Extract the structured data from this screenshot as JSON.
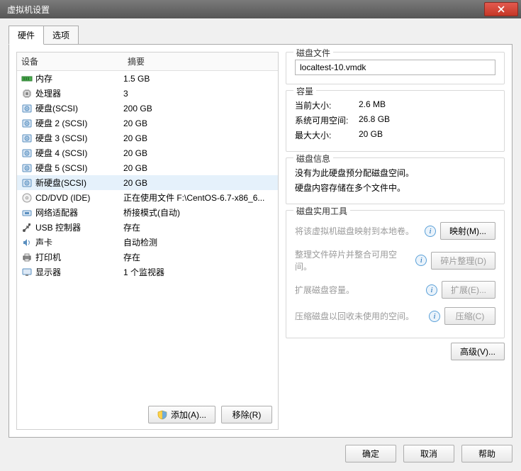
{
  "window": {
    "title": "虚拟机设置"
  },
  "tabs": {
    "hardware": "硬件",
    "options": "选项"
  },
  "left": {
    "col_device": "设备",
    "col_summary": "摘要",
    "rows": [
      {
        "icon": "memory",
        "name": "内存",
        "summary": "1.5 GB"
      },
      {
        "icon": "cpu",
        "name": "处理器",
        "summary": "3"
      },
      {
        "icon": "hdd",
        "name": "硬盘(SCSI)",
        "summary": "200 GB"
      },
      {
        "icon": "hdd",
        "name": "硬盘 2 (SCSI)",
        "summary": "20 GB"
      },
      {
        "icon": "hdd",
        "name": "硬盘 3 (SCSI)",
        "summary": "20 GB"
      },
      {
        "icon": "hdd",
        "name": "硬盘 4 (SCSI)",
        "summary": "20 GB"
      },
      {
        "icon": "hdd",
        "name": "硬盘 5 (SCSI)",
        "summary": "20 GB"
      },
      {
        "icon": "hdd",
        "name": "新硬盘(SCSI)",
        "summary": "20 GB",
        "selected": true
      },
      {
        "icon": "cd",
        "name": "CD/DVD (IDE)",
        "summary": "正在使用文件 F:\\CentOS-6.7-x86_6..."
      },
      {
        "icon": "net",
        "name": "网络适配器",
        "summary": "桥接模式(自动)"
      },
      {
        "icon": "usb",
        "name": "USB 控制器",
        "summary": "存在"
      },
      {
        "icon": "sound",
        "name": "声卡",
        "summary": "自动检测"
      },
      {
        "icon": "printer",
        "name": "打印机",
        "summary": "存在"
      },
      {
        "icon": "display",
        "name": "显示器",
        "summary": "1 个监视器"
      }
    ],
    "add_btn": "添加(A)...",
    "remove_btn": "移除(R)"
  },
  "right": {
    "disk_file": {
      "legend": "磁盘文件",
      "value": "localtest-10.vmdk"
    },
    "capacity": {
      "legend": "容量",
      "current_k": "当前大小:",
      "current_v": "2.6 MB",
      "free_k": "系统可用空间:",
      "free_v": "26.8 GB",
      "max_k": "最大大小:",
      "max_v": "20 GB"
    },
    "disk_info": {
      "legend": "磁盘信息",
      "line1": "没有为此硬盘预分配磁盘空间。",
      "line2": "硬盘内容存储在多个文件中。"
    },
    "utilities": {
      "legend": "磁盘实用工具",
      "map_desc": "将该虚拟机磁盘映射到本地卷。",
      "map_btn": "映射(M)...",
      "defrag_desc": "整理文件碎片并整合可用空间。",
      "defrag_btn": "碎片整理(D)",
      "expand_desc": "扩展磁盘容量。",
      "expand_btn": "扩展(E)...",
      "compact_desc": "压缩磁盘以回收未使用的空间。",
      "compact_btn": "压缩(C)"
    },
    "advanced_btn": "高级(V)..."
  },
  "footer": {
    "ok": "确定",
    "cancel": "取消",
    "help": "帮助"
  }
}
